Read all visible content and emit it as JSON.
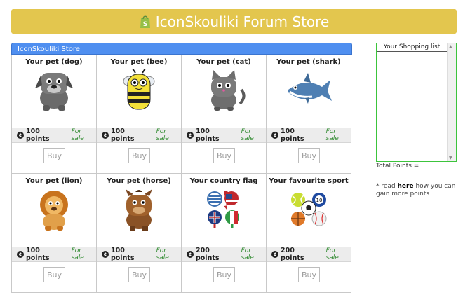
{
  "banner": {
    "title": "IconSkouliki Forum Store",
    "icon": "shopify-bag-icon",
    "color": "#e3c64e"
  },
  "store": {
    "header": "IconSkouliki Store",
    "items": [
      {
        "title": "Your pet (dog)",
        "points": "100 points",
        "status": "For sale",
        "buy": "Buy",
        "icon": "dog"
      },
      {
        "title": "Your pet (bee)",
        "points": "100 points",
        "status": "For sale",
        "buy": "Buy",
        "icon": "bee"
      },
      {
        "title": "Your pet (cat)",
        "points": "100 points",
        "status": "For sale",
        "buy": "Buy",
        "icon": "cat"
      },
      {
        "title": "Your pet (shark)",
        "points": "100 points",
        "status": "For sale",
        "buy": "Buy",
        "icon": "shark"
      },
      {
        "title": "Your pet (lion)",
        "points": "100 points",
        "status": "For sale",
        "buy": "Buy",
        "icon": "lion"
      },
      {
        "title": "Your pet (horse)",
        "points": "100 points",
        "status": "For sale",
        "buy": "Buy",
        "icon": "horse"
      },
      {
        "title": "Your country flag",
        "points": "200 points",
        "status": "For sale",
        "buy": "Buy",
        "icon": "flags"
      },
      {
        "title": "Your favourite sport",
        "points": "200 points",
        "status": "For sale",
        "buy": "Buy",
        "icon": "sports-balls"
      }
    ]
  },
  "cart": {
    "title": "Your Shopping list",
    "total_label": "Total Points =",
    "note_prefix": "* read",
    "note_link": "here",
    "note_suffix": "how you can gain more points"
  }
}
